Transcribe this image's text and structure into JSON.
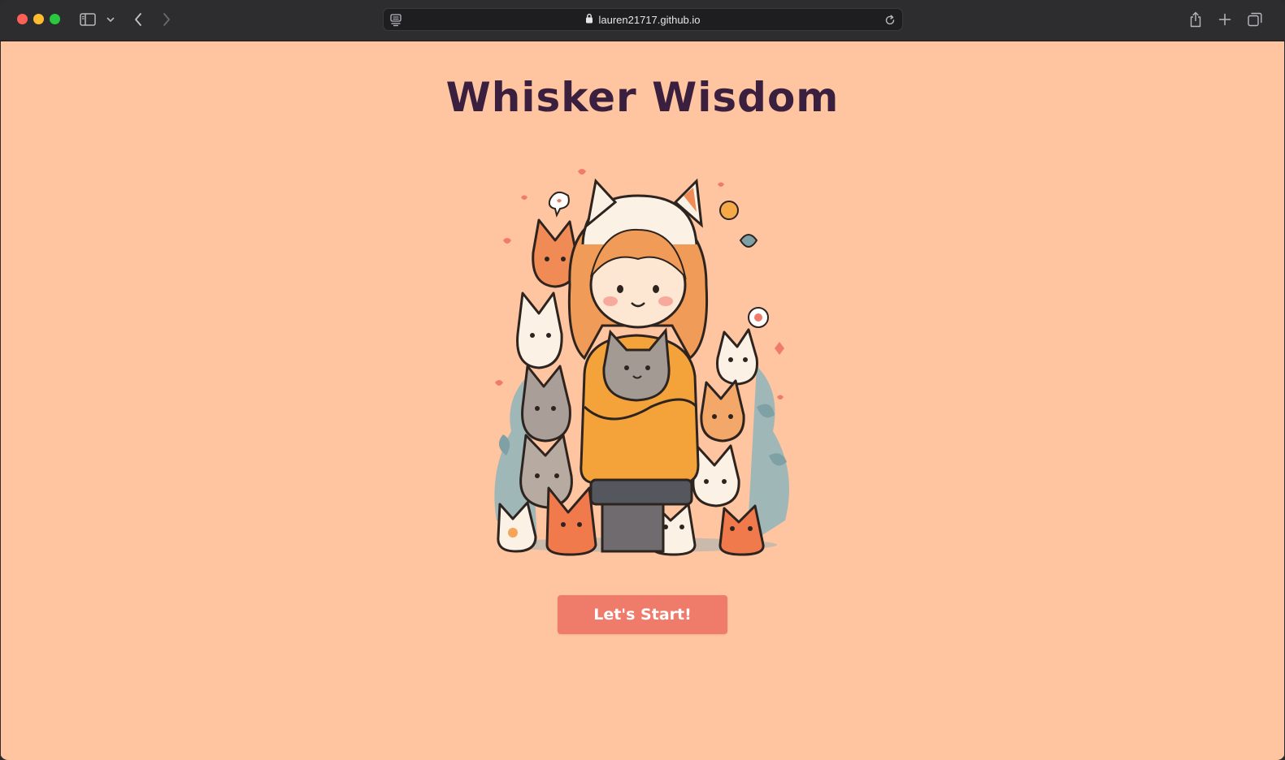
{
  "browser": {
    "url": "lauren21717.github.io",
    "icons": {
      "sidebar": "sidebar-icon",
      "sidebar_menu": "chevron-down-icon",
      "back": "chevron-left-icon",
      "forward": "chevron-right-icon",
      "reader": "reader-icon",
      "lock": "lock-icon",
      "reload": "reload-icon",
      "share": "share-icon",
      "new_tab": "plus-icon",
      "tabs": "tabs-overview-icon"
    }
  },
  "page": {
    "title": "Whisker Wisdom",
    "start_button": "Let's Start!",
    "colors": {
      "background": "#ffc4a0",
      "title": "#3a1f3f",
      "button": "#ef7b6b",
      "button_text": "#ffffff"
    }
  }
}
